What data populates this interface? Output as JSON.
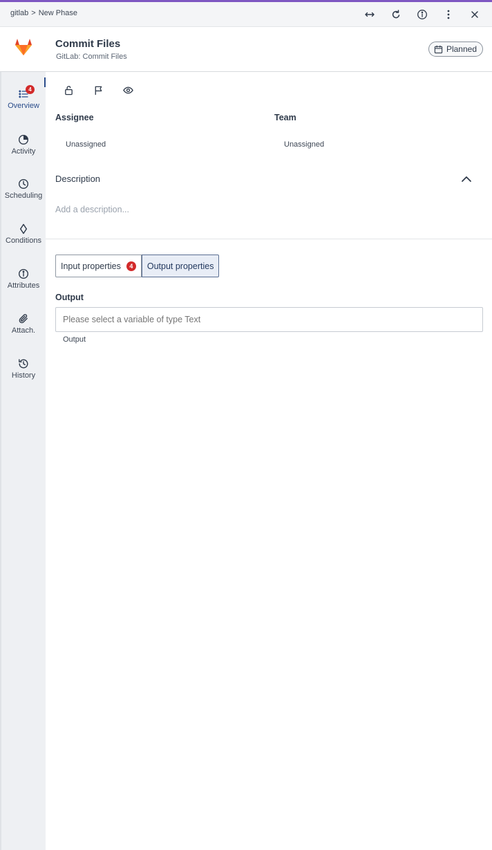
{
  "breadcrumb": {
    "root": "gitlab",
    "separator": ">",
    "current": "New Phase"
  },
  "top_actions": [
    "expand-horizontal-icon",
    "refresh-icon",
    "info-icon",
    "more-vertical-icon",
    "close-icon"
  ],
  "header": {
    "title": "Commit Files",
    "subtitle": "GitLab: Commit Files",
    "status": "Planned"
  },
  "sidebar": {
    "items": [
      {
        "label": "Overview",
        "icon": "list-icon",
        "badge": "4",
        "active": true
      },
      {
        "label": "Activity",
        "icon": "activity-icon"
      },
      {
        "label": "Scheduling",
        "icon": "clock-icon"
      },
      {
        "label": "Conditions",
        "icon": "diamond-icon"
      },
      {
        "label": "Attributes",
        "icon": "info-icon"
      },
      {
        "label": "Attach.",
        "icon": "paperclip-icon"
      },
      {
        "label": "History",
        "icon": "history-icon"
      }
    ]
  },
  "toolbar": [
    "lock-icon",
    "flag-icon",
    "eye-icon"
  ],
  "fields": {
    "assignee_label": "Assignee",
    "assignee_value": "Unassigned",
    "team_label": "Team",
    "team_value": "Unassigned"
  },
  "description": {
    "title": "Description",
    "placeholder": "Add a description..."
  },
  "tabs": [
    {
      "label": "Input properties",
      "badge": "4",
      "selected": false
    },
    {
      "label": "Output properties",
      "selected": true
    }
  ],
  "output": {
    "label": "Output",
    "placeholder": "Please select a variable of type Text",
    "helper": "Output"
  },
  "colors": {
    "accent": "#7e57c2",
    "active_nav": "#2a4c8a",
    "badge": "#d22a2a",
    "gitlab_orange": "#e24329"
  }
}
